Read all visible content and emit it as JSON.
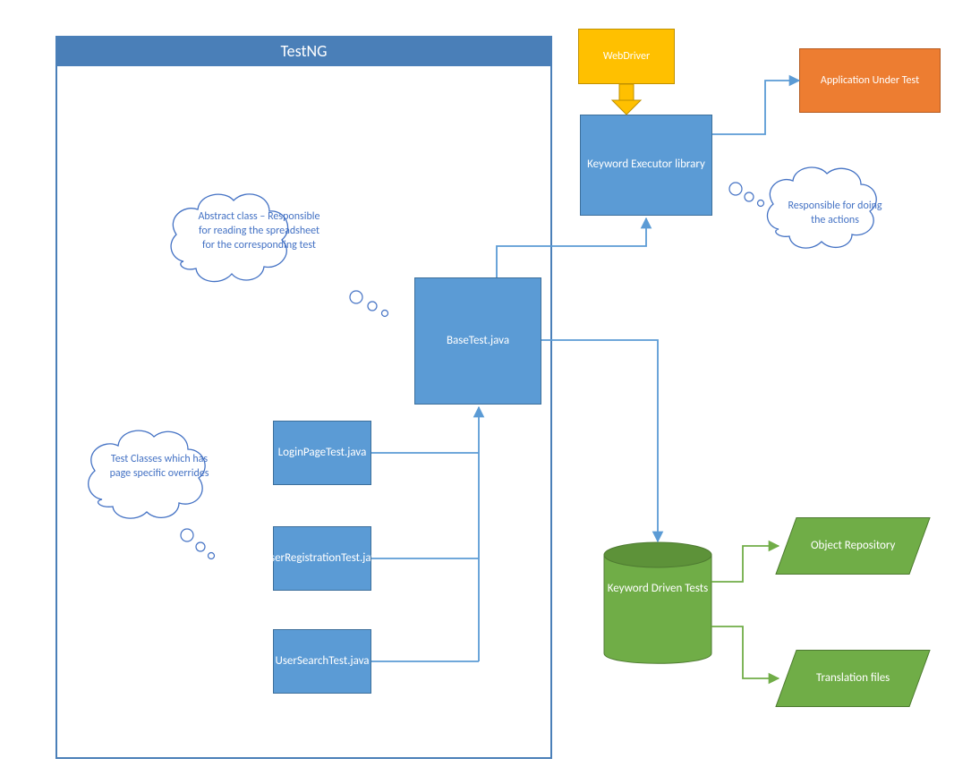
{
  "testng": {
    "title": "TestNG",
    "baseTest": "BaseTest.java",
    "tests": [
      "LoginPageTest.java",
      "UserRegistrationTest.java",
      "UserSearchTest.java"
    ]
  },
  "webdriver": {
    "label": "WebDriver"
  },
  "keywordExecutor": {
    "label": "Keyword Executor library"
  },
  "appUnderTest": {
    "label": "Application Under Test"
  },
  "clouds": {
    "abstractClass": "Abstract class – Responsible for reading the spreadsheet for the corresponding test",
    "testClasses": "Test Classes which has page specific overrides",
    "actions": "Responsible for doing the actions"
  },
  "datastore": {
    "keywordDriven": "Keyword Driven Tests",
    "objectRepo": "Object Repository",
    "translation": "Translation files"
  },
  "colors": {
    "blue": "#5b9bd5",
    "orange": "#ed7d31",
    "yellow": "#ffc000",
    "green": "#70ad47",
    "text": "#4472c4"
  }
}
